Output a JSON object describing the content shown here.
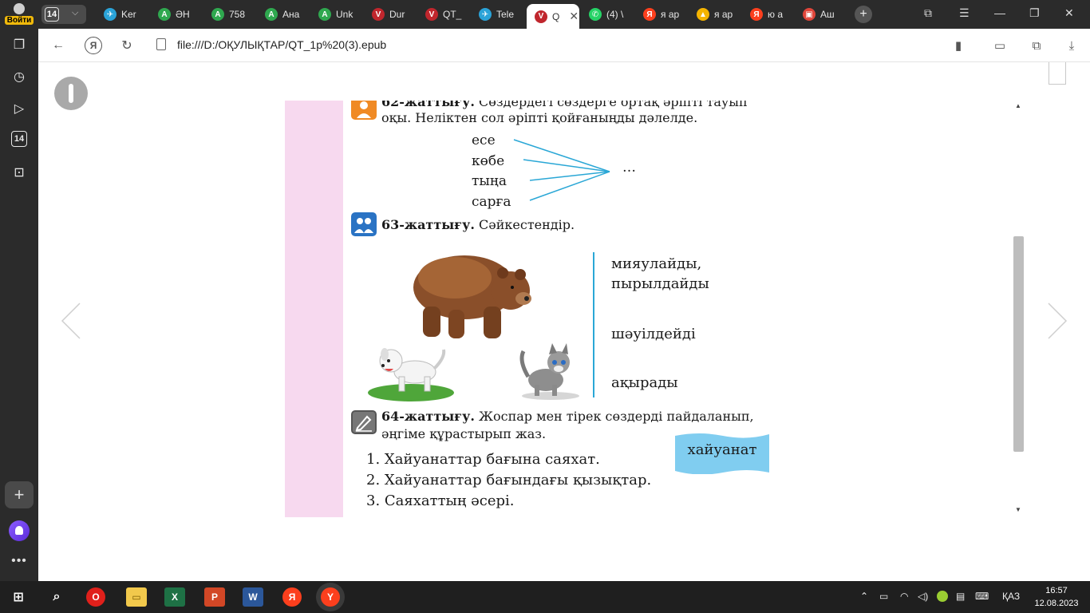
{
  "sidebar": {
    "login_label": "Войти",
    "tabs_badge": "14"
  },
  "tabbar": {
    "tab_count": "14",
    "tabs": [
      {
        "label": "Ker",
        "color": "#2aa3d8",
        "glyph": "✈"
      },
      {
        "label": "ӘН",
        "color": "#2fa84f",
        "glyph": "A"
      },
      {
        "label": "758",
        "color": "#2fa84f",
        "glyph": "A"
      },
      {
        "label": "Ана",
        "color": "#2fa84f",
        "glyph": "A"
      },
      {
        "label": "Unk",
        "color": "#2fa84f",
        "glyph": "A"
      },
      {
        "label": "Dur",
        "color": "#c0262d",
        "glyph": "V"
      },
      {
        "label": "QT_",
        "color": "#c0262d",
        "glyph": "V"
      },
      {
        "label": "Tele",
        "color": "#2aa3d8",
        "glyph": "✈"
      },
      {
        "label": "Q",
        "color": "#c0262d",
        "glyph": "V"
      },
      {
        "label": "(4) \\",
        "color": "#25d366",
        "glyph": "✆"
      },
      {
        "label": "я ар",
        "color": "#fc3f1d",
        "glyph": "Я"
      },
      {
        "label": "я ар",
        "color": "#f5b400",
        "glyph": "▲"
      },
      {
        "label": "ю а",
        "color": "#fc3f1d",
        "glyph": "Я"
      },
      {
        "label": "Аш",
        "color": "#e0453a",
        "glyph": "▣"
      }
    ]
  },
  "address": {
    "url": "file:///D:/ОҚУЛЫҚТАР/QT_1p%20(3).epub"
  },
  "book": {
    "ex62": {
      "number": "62-жаттығу.",
      "text1": "Сөздердегі сөздерге ортақ әріпті тауып",
      "text2": "оқы. Неліктен сол әріпті қойғаныңды дәлелде.",
      "words": [
        "есе",
        "көбе",
        "тыңа",
        "сарға"
      ],
      "target": "…"
    },
    "ex63": {
      "number": "63-жаттығу.",
      "text": "Сәйкестендір.",
      "answers": [
        "мияулайды,",
        "пырылдайды",
        "шәуілдейді",
        "ақырады"
      ]
    },
    "ex64": {
      "number": "64-жаттығу.",
      "text1": "Жоспар мен тірек сөздерді пайдаланып,",
      "text2": "әңгіме құрастырып жаз.",
      "plan": [
        "1. Хайуанаттар бағына саяхат.",
        "2. Хайуанаттар бағындағы қызықтар.",
        "3. Саяхаттың әсері."
      ],
      "keyword": "хайуанат"
    }
  },
  "taskbar": {
    "lang": "ҚАЗ",
    "time": "16:57",
    "date": "12.08.2023"
  }
}
